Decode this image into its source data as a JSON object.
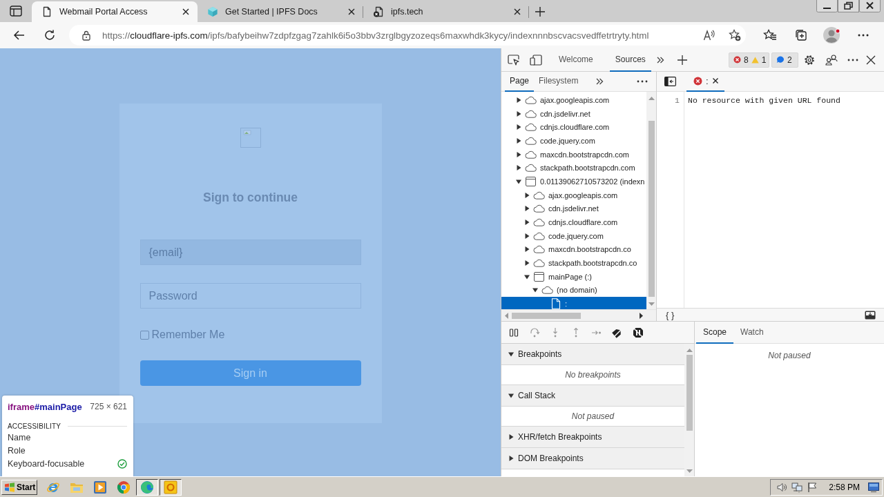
{
  "browser": {
    "tabs": [
      {
        "title": "Webmail Portal Access",
        "kind": "page",
        "selected": true
      },
      {
        "title": "Get Started | IPFS Docs",
        "kind": "cube",
        "selected": false
      },
      {
        "title": "ipfs.tech",
        "kind": "error-page",
        "selected": false
      }
    ],
    "address": {
      "scheme": "https://",
      "host": "cloudflare-ipfs.com",
      "path": "/ipfs/bafybeihw7zdpfzgag7zahlk6i5o3bbv3zrglbgyzozeqs6maxwhdk3kycy/indexnnnbscvacsvedffetrtryty.html"
    }
  },
  "page": {
    "heading": "Sign to continue",
    "email_field": {
      "value": "{email}"
    },
    "password_field": {
      "placeholder": "Password"
    },
    "remember_me": {
      "label": "Remember Me",
      "checked": false
    },
    "sign_in_button": "Sign in"
  },
  "inspect_tooltip": {
    "tag": "iframe",
    "id": "#mainPage",
    "size": "725 × 621",
    "section": "ACCESSIBILITY",
    "properties": [
      {
        "name": "Name",
        "kind": "text"
      },
      {
        "name": "Role",
        "kind": "text"
      },
      {
        "name": "Keyboard-focusable",
        "kind": "check",
        "checked": true
      }
    ]
  },
  "devtools": {
    "tabs": [
      {
        "label": "Welcome",
        "selected": false
      },
      {
        "label": "Sources",
        "selected": true
      }
    ],
    "issues": {
      "errors": "8",
      "warnings": "1",
      "info": "2"
    },
    "navigator": {
      "tabs": [
        {
          "label": "Page",
          "selected": true
        },
        {
          "label": "Filesystem",
          "selected": false
        }
      ],
      "tree": [
        {
          "label": "ajax.googleapis.com",
          "kind": "domain",
          "expanded": false,
          "selected": false
        },
        {
          "label": "cdn.jsdelivr.net",
          "kind": "domain",
          "expanded": false,
          "selected": false
        },
        {
          "label": "cdnjs.cloudflare.com",
          "kind": "domain",
          "expanded": false,
          "selected": false
        },
        {
          "label": "code.jquery.com",
          "kind": "domain",
          "expanded": false,
          "selected": false
        },
        {
          "label": "maxcdn.bootstrapcdn.com",
          "kind": "domain",
          "expanded": false,
          "selected": false
        },
        {
          "label": "stackpath.bootstrapcdn.com",
          "kind": "domain",
          "expanded": false,
          "selected": false
        },
        {
          "label": "0.01139062710573202 (indexn",
          "kind": "frame",
          "expanded": true,
          "selected": false,
          "children": [
            {
              "label": "ajax.googleapis.com",
              "kind": "domain",
              "expanded": false,
              "selected": false
            },
            {
              "label": "cdn.jsdelivr.net",
              "kind": "domain",
              "expanded": false,
              "selected": false
            },
            {
              "label": "cdnjs.cloudflare.com",
              "kind": "domain",
              "expanded": false,
              "selected": false
            },
            {
              "label": "code.jquery.com",
              "kind": "domain",
              "expanded": false,
              "selected": false
            },
            {
              "label": "maxcdn.bootstrapcdn.co",
              "kind": "domain",
              "expanded": false,
              "selected": false
            },
            {
              "label": "stackpath.bootstrapcdn.co",
              "kind": "domain",
              "expanded": false,
              "selected": false
            },
            {
              "label": "mainPage (:)",
              "kind": "frame",
              "expanded": true,
              "selected": false,
              "children": [
                {
                  "label": "(no domain)",
                  "kind": "domain",
                  "expanded": true,
                  "selected": false,
                  "children": [
                    {
                      "label": ":",
                      "kind": "file",
                      "selected": true
                    }
                  ]
                }
              ]
            }
          ]
        }
      ]
    },
    "editor": {
      "tabs": [
        {
          "label": ":",
          "error": true,
          "selected": true
        }
      ],
      "lines": [
        {
          "number": "1",
          "text": "No resource with given URL found"
        }
      ],
      "format_button": "{ }"
    },
    "debugger": {
      "sections": [
        {
          "title": "Breakpoints",
          "expanded": true,
          "message": "No breakpoints"
        },
        {
          "title": "Call Stack",
          "expanded": true,
          "message": "Not paused"
        },
        {
          "title": "XHR/fetch Breakpoints",
          "expanded": false
        },
        {
          "title": "DOM Breakpoints",
          "expanded": false
        }
      ],
      "sidebar_tabs": [
        {
          "label": "Scope",
          "selected": true
        },
        {
          "label": "Watch",
          "selected": false
        }
      ],
      "sidebar_message": "Not paused"
    }
  },
  "taskbar": {
    "start": "Start",
    "apps": [
      {
        "kind": "globe",
        "active": false
      },
      {
        "kind": "folder",
        "active": false
      },
      {
        "kind": "media",
        "active": false
      },
      {
        "kind": "chrome",
        "active": false
      },
      {
        "kind": "edge",
        "active": true
      },
      {
        "kind": "tile",
        "active": true
      }
    ],
    "clock": "2:58 PM"
  }
}
